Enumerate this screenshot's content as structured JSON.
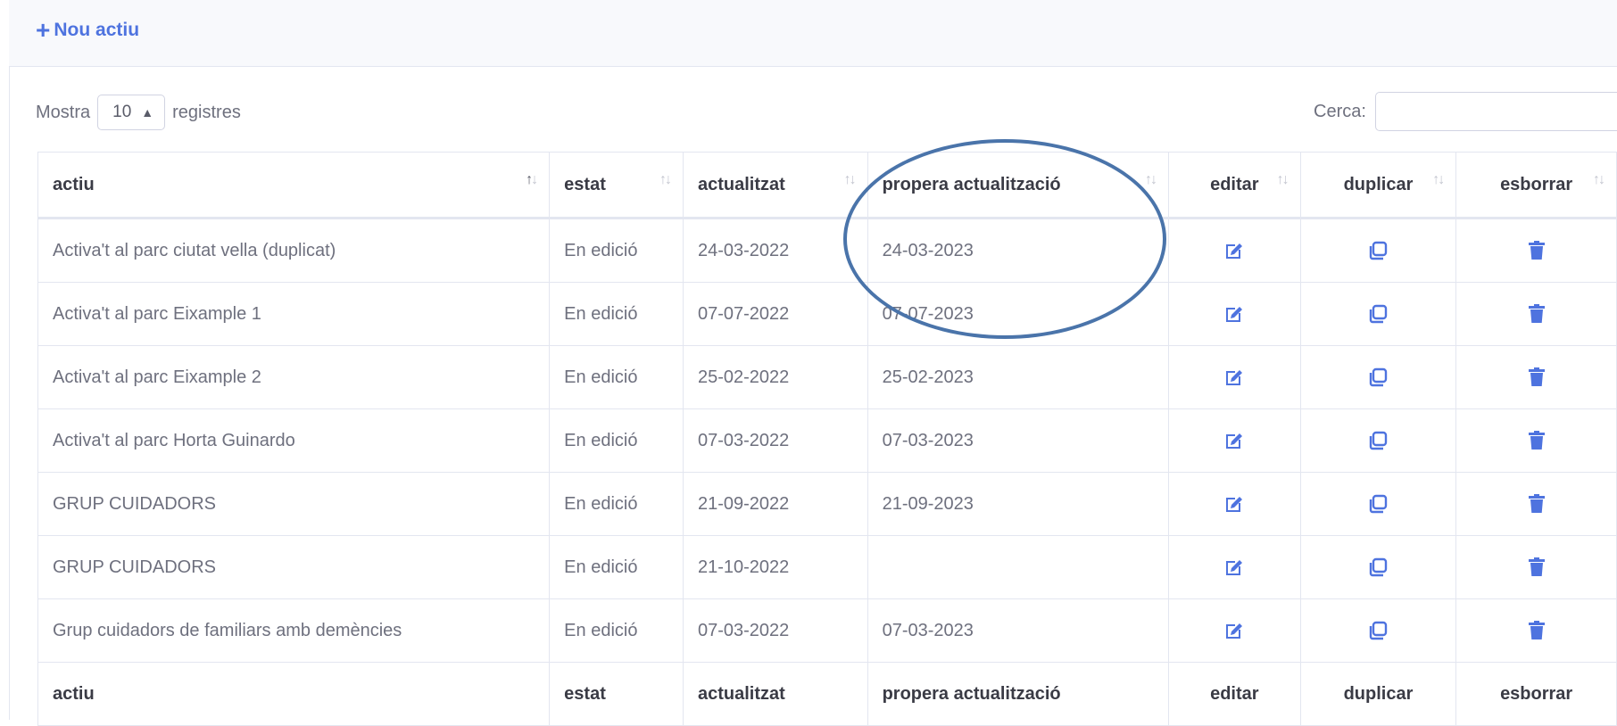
{
  "toolbar": {
    "new_label": "Nou actiu"
  },
  "length_control": {
    "prefix": "Mostra",
    "value": "10",
    "suffix": "registres"
  },
  "search": {
    "label": "Cerca:",
    "value": "",
    "placeholder": ""
  },
  "columns": [
    "actiu",
    "estat",
    "actualitzat",
    "propera actualització",
    "editar",
    "duplicar",
    "esborrar"
  ],
  "rows": [
    {
      "actiu": "Activa't al parc ciutat vella (duplicat)",
      "estat": "En edició",
      "actualitzat": "24-03-2022",
      "propera": "24-03-2023"
    },
    {
      "actiu": "Activa't al parc Eixample 1",
      "estat": "En edició",
      "actualitzat": "07-07-2022",
      "propera": "07-07-2023"
    },
    {
      "actiu": "Activa't al parc Eixample 2",
      "estat": "En edició",
      "actualitzat": "25-02-2022",
      "propera": "25-02-2023"
    },
    {
      "actiu": "Activa't al parc Horta Guinardo",
      "estat": "En edició",
      "actualitzat": "07-03-2022",
      "propera": "07-03-2023"
    },
    {
      "actiu": "GRUP CUIDADORS",
      "estat": "En edició",
      "actualitzat": "21-09-2022",
      "propera": "21-09-2023"
    },
    {
      "actiu": "GRUP CUIDADORS",
      "estat": "En edició",
      "actualitzat": "21-10-2022",
      "propera": ""
    },
    {
      "actiu": "Grup cuidadors de familiars amb demències",
      "estat": "En edició",
      "actualitzat": "07-03-2022",
      "propera": "07-03-2023"
    }
  ],
  "icons": {
    "edit": "edit-icon",
    "duplicate": "copy-icon",
    "delete": "trash-icon",
    "sort": "sort-arrows-icon",
    "plus": "plus-icon"
  },
  "colors": {
    "accent": "#4e73df",
    "annotation": "#4a74aa"
  }
}
